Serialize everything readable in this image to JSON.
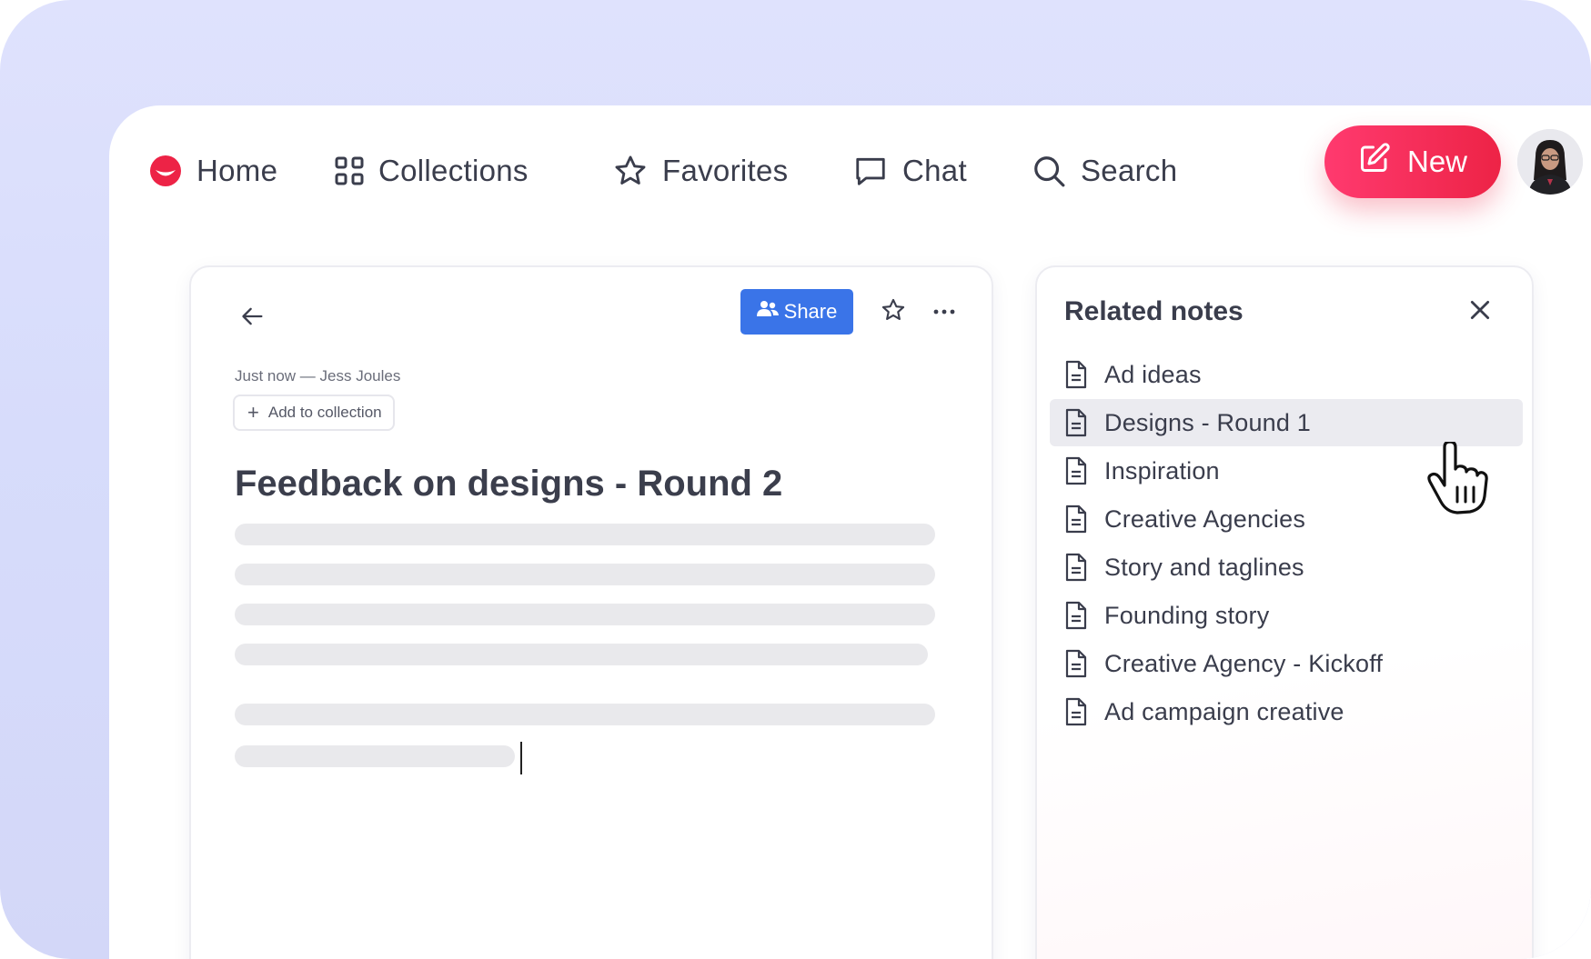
{
  "nav": {
    "home": "Home",
    "collections": "Collections",
    "favorites": "Favorites",
    "chat": "Chat",
    "search": "Search",
    "new_label": "New"
  },
  "colors": {
    "brand": "#ed2346",
    "share": "#3a74e8",
    "text": "#3a3d4c",
    "background": "#dfe2fd"
  },
  "editor": {
    "share_label": "Share",
    "meta": "Just now — Jess Joules",
    "add_to_collection": "Add to collection",
    "title": "Feedback on designs - Round 2"
  },
  "related": {
    "title": "Related notes",
    "notes": [
      "Ad ideas",
      "Designs - Round 1",
      "Inspiration",
      "Creative Agencies",
      "Story and taglines",
      "Founding story",
      "Creative Agency - Kickoff",
      "Ad campaign creative"
    ]
  },
  "icons": {
    "home": "home-logo-icon",
    "collections": "grid-icon",
    "favorites": "star-icon",
    "chat": "chat-bubble-icon",
    "search": "search-icon",
    "new": "edit-icon",
    "note": "document-icon",
    "close": "close-icon",
    "back": "arrow-left-icon",
    "more": "more-horizontal-icon",
    "cursor": "hand-pointer-icon"
  }
}
